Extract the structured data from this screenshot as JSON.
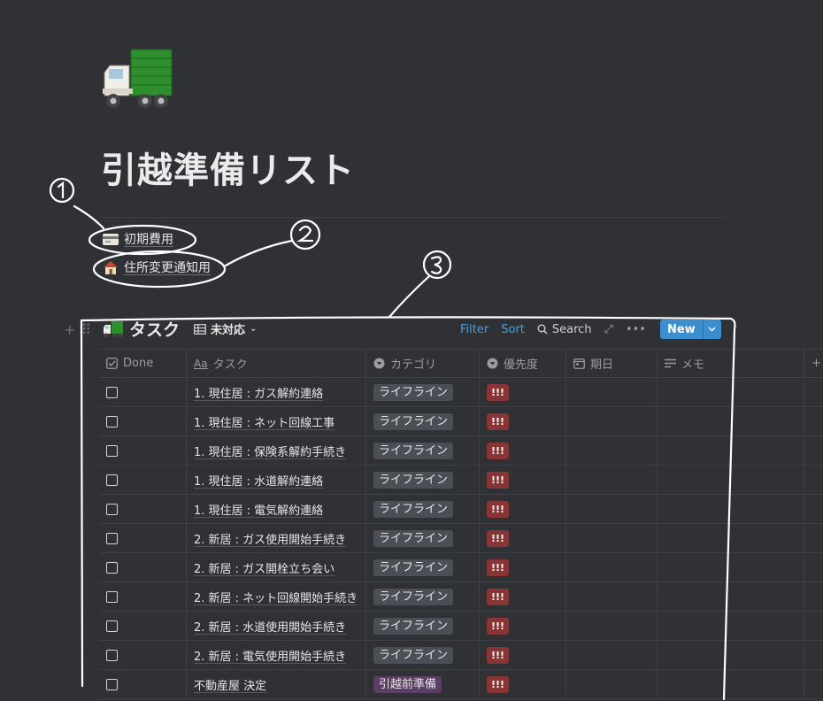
{
  "page": {
    "icon": "truck-icon",
    "title": "引越準備リスト"
  },
  "linked_pages": [
    {
      "icon": "credit-card-icon",
      "label": "初期費用"
    },
    {
      "icon": "house-icon",
      "label": "住所変更通知用"
    }
  ],
  "database": {
    "icon": "truck-icon",
    "title": "タスク",
    "view": {
      "icon": "table-icon",
      "label": "未対応"
    },
    "toolbar": {
      "filter": "Filter",
      "sort": "Sort",
      "search": "Search",
      "new": "New"
    },
    "columns": [
      {
        "key": "done",
        "icon": "checkbox-icon",
        "label": "Done"
      },
      {
        "key": "task",
        "icon": "Aa",
        "label": "タスク"
      },
      {
        "key": "category",
        "icon": "select-icon",
        "label": "カテゴリ"
      },
      {
        "key": "priority",
        "icon": "select-icon",
        "label": "優先度"
      },
      {
        "key": "date",
        "icon": "calendar-icon",
        "label": "期日"
      },
      {
        "key": "memo",
        "icon": "text-icon",
        "label": "メモ"
      }
    ],
    "rows": [
      {
        "task": "1. 現住居 : ガス解約連絡",
        "category": "ライフライン",
        "priority": "!!!"
      },
      {
        "task": "1. 現住居 : ネット回線工事",
        "category": "ライフライン",
        "priority": "!!!"
      },
      {
        "task": "1. 現住居 : 保険系解約手続き",
        "category": "ライフライン",
        "priority": "!!!"
      },
      {
        "task": "1. 現住居 : 水道解約連絡",
        "category": "ライフライン",
        "priority": "!!!"
      },
      {
        "task": "1. 現住居 : 電気解約連絡",
        "category": "ライフライン",
        "priority": "!!!"
      },
      {
        "task": "2. 新居 : ガス使用開始手続き",
        "category": "ライフライン",
        "priority": "!!!"
      },
      {
        "task": "2. 新居 : ガス開栓立ち会い",
        "category": "ライフライン",
        "priority": "!!!"
      },
      {
        "task": "2. 新居 : ネット回線開始手続き",
        "category": "ライフライン",
        "priority": "!!!"
      },
      {
        "task": "2. 新居 : 水道使用開始手続き",
        "category": "ライフライン",
        "priority": "!!!"
      },
      {
        "task": "2. 新居 : 電気使用開始手続き",
        "category": "ライフライン",
        "priority": "!!!"
      },
      {
        "task": "不動産屋 決定",
        "category": "引越前準備",
        "priority": "!!!"
      }
    ]
  },
  "annotations": [
    "1",
    "2",
    "3"
  ],
  "colors": {
    "background": "#2f3135",
    "accent": "#3b8ed0",
    "tag_gray": "#4b4f55",
    "tag_purple": "#5a3e63",
    "tag_red": "#8a3535"
  }
}
